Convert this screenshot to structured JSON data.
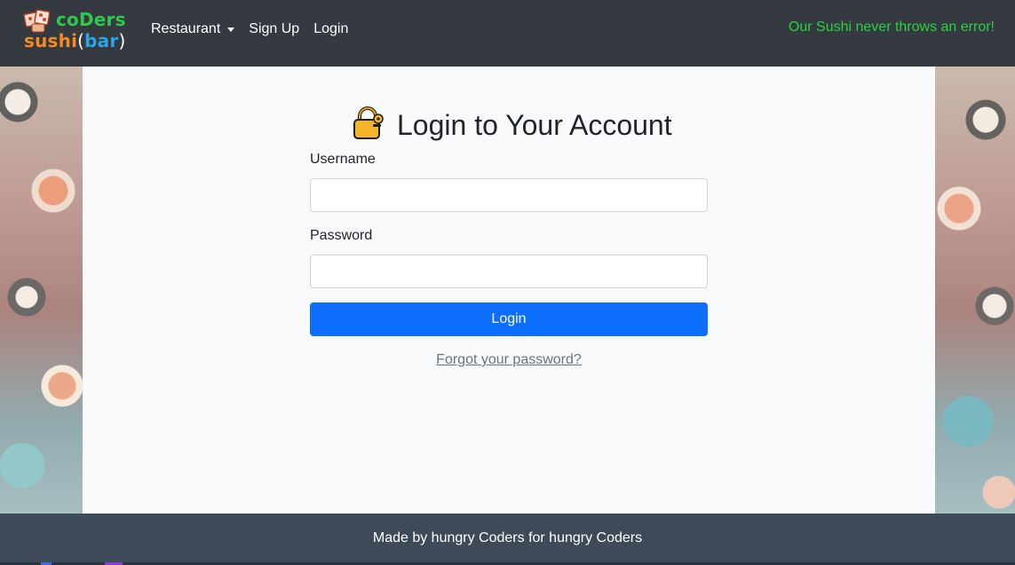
{
  "brand": {
    "line1": "coDers",
    "line2_sushi": "sushi",
    "line2_open": "(",
    "line2_bar": "bar",
    "line2_close": ")",
    "icon": "sushi-dice-icon"
  },
  "nav": {
    "items": [
      {
        "label": "Restaurant",
        "has_dropdown": true
      },
      {
        "label": "Sign Up"
      },
      {
        "label": "Login"
      }
    ],
    "tagline": "Our Sushi never throws an error!"
  },
  "login": {
    "icon": "lock-icon",
    "title": "Login to Your Account",
    "username_label": "Username",
    "username_value": "",
    "password_label": "Password",
    "password_value": "",
    "button_label": "Login",
    "forgot_label": "Forgot your password?"
  },
  "footer": {
    "text": "Made by hungry Coders for hungry Coders"
  },
  "colors": {
    "navbar": "#343a40",
    "tagline": "#28d23e",
    "primary_button": "#0d6efd",
    "footer": "#3f4a59",
    "panel": "#f8f9fa"
  }
}
